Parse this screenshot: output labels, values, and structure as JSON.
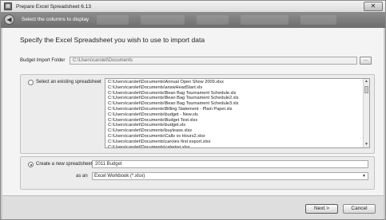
{
  "window": {
    "title": "Prepare Excel Spreadsheet 6.13",
    "close_glyph": "✕"
  },
  "nav": {
    "back_glyph": "◀",
    "step_title": "Select the columns to display"
  },
  "main": {
    "heading": "Specify the Excel Spreadsheet you wish to use to import data",
    "folder": {
      "label": "Budget Import Folder",
      "value": "C:\\Users\\carolet\\Documents",
      "browse_label": "..."
    },
    "existing": {
      "label": "Select an existing spreadsheet",
      "files": [
        "C:\\Users\\carolet\\Documents\\Annual Open Show 2009.xlsx",
        "C:\\Users\\carolet\\Documents\\answHeadStart.xls",
        "C:\\Users\\carolet\\Documents\\Bean Bag Tournament Schedule.xls",
        "C:\\Users\\carolet\\Documents\\Bean Bag Tournament Schedule2.xls",
        "C:\\Users\\carolet\\Documents\\Bean Bag Tournament Schedule3.xls",
        "C:\\Users\\carolet\\Documents\\Billing Statement - Plain Paper.xls",
        "C:\\Users\\carolet\\Documents\\budget - New.xls",
        "C:\\Users\\carolet\\Documents\\Budget Test.xlsx",
        "C:\\Users\\carolet\\Documents\\budget.xls",
        "C:\\Users\\carolet\\Documents\\buylease.xlsx",
        "C:\\Users\\carolet\\Documents\\Calls vs Hours2.xlsx",
        "C:\\Users\\carolet\\Documents\\caroles first export.xlsx",
        "C:\\Users\\carolet\\Documents\\catering.xlsx"
      ]
    },
    "create": {
      "label": "Create a new spreadsheet",
      "name_value": "2011 Budget",
      "save_as_label": "as an",
      "format_value": "Excel Workbook (*.xlsx)",
      "dropdown_glyph": "▼"
    }
  },
  "footer": {
    "next_label": "Next >",
    "cancel_label": "Cancel"
  }
}
